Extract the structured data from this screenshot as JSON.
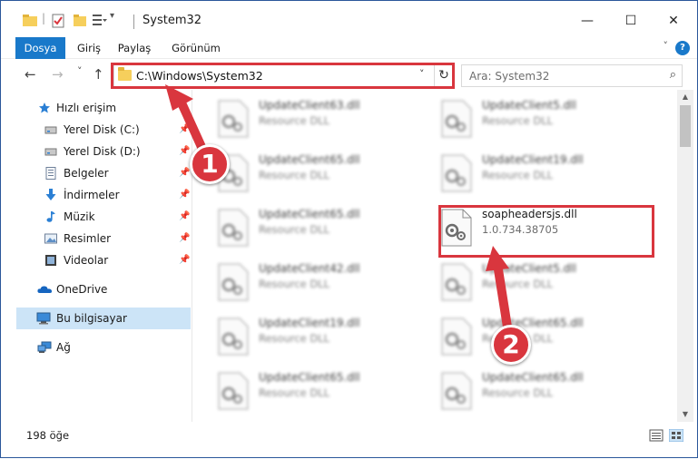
{
  "window": {
    "title": "System32",
    "controls": {
      "minimize": "—",
      "maximize": "☐",
      "close": "✕"
    }
  },
  "ribbon": {
    "tabs": [
      {
        "label": "Dosya",
        "active": true
      },
      {
        "label": "Giriş",
        "active": false
      },
      {
        "label": "Paylaş",
        "active": false
      },
      {
        "label": "Görünüm",
        "active": false
      }
    ],
    "help": "?"
  },
  "navigation": {
    "back": "←",
    "forward": "→",
    "recent": "˅",
    "up": "↑",
    "address_path": "C:\\Windows\\System32",
    "address_dropdown": "˅",
    "refresh": "↻",
    "search_placeholder": "Ara: System32",
    "search_icon": "⌕"
  },
  "sidebar": {
    "items": [
      {
        "label": "Hızlı erişim",
        "icon": "star-icon",
        "pinned": false
      },
      {
        "label": "Yerel Disk (C:)",
        "icon": "drive-icon",
        "pinned": true
      },
      {
        "label": "Yerel Disk (D:)",
        "icon": "drive-icon",
        "pinned": true
      },
      {
        "label": "Belgeler",
        "icon": "documents-icon",
        "pinned": true
      },
      {
        "label": "İndirmeler",
        "icon": "download-icon",
        "pinned": true
      },
      {
        "label": "Müzik",
        "icon": "music-icon",
        "pinned": true
      },
      {
        "label": "Resimler",
        "icon": "pictures-icon",
        "pinned": true
      },
      {
        "label": "Videolar",
        "icon": "videos-icon",
        "pinned": true
      },
      {
        "label": "OneDrive",
        "icon": "cloud-icon",
        "pinned": false
      },
      {
        "label": "Bu bilgisayar",
        "icon": "computer-icon",
        "pinned": false,
        "selected": true
      },
      {
        "label": "Ağ",
        "icon": "network-icon",
        "pinned": false
      }
    ],
    "pin_glyph": "📌"
  },
  "files": {
    "left_column": [
      {
        "name": "UpdateClient63.dll",
        "desc": "Resource DLL"
      },
      {
        "name": "UpdateClient65.dll",
        "desc": "Resource DLL"
      },
      {
        "name": "UpdateClient65.dll",
        "desc": "Resource DLL"
      },
      {
        "name": "UpdateClient42.dll",
        "desc": "Resource DLL"
      },
      {
        "name": "UpdateClient19.dll",
        "desc": "Resource DLL"
      },
      {
        "name": "UpdateClient65.dll",
        "desc": "Resource DLL"
      }
    ],
    "right_column": [
      {
        "name": "UpdateClient5.dll",
        "desc": "Resource DLL"
      },
      {
        "name": "UpdateClient19.dll",
        "desc": "Resource DLL"
      },
      {
        "name": "soapheadersjs.dll",
        "desc": "1.0.734.38705",
        "highlighted": true
      },
      {
        "name": "UpdateClient5.dll",
        "desc": "Resource DLL"
      },
      {
        "name": "UpdateClient65.dll",
        "desc": "Resource DLL"
      },
      {
        "name": "UpdateClient65.dll",
        "desc": "Resource DLL"
      }
    ]
  },
  "status": {
    "item_count": "198 öğe"
  },
  "annotations": {
    "marker_1": "1",
    "marker_2": "2",
    "color": "#d9363e"
  },
  "colors": {
    "accent": "#1979ca",
    "selection": "#cce4f7",
    "annotation": "#d9363e"
  }
}
